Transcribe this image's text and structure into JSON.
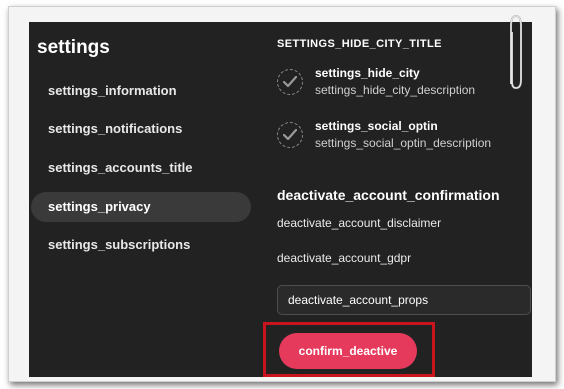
{
  "sidebar": {
    "title": "settings",
    "items": [
      {
        "label": "settings_information",
        "active": false
      },
      {
        "label": "settings_notifications",
        "active": false
      },
      {
        "label": "settings_accounts_title",
        "active": false
      },
      {
        "label": "settings_privacy",
        "active": true
      },
      {
        "label": "settings_subscriptions",
        "active": false
      }
    ]
  },
  "content": {
    "section_title": "SETTINGS_HIDE_CITY_TITLE",
    "options": [
      {
        "title": "settings_hide_city",
        "description": "settings_hide_city_description",
        "checked": true
      },
      {
        "title": "settings_social_optin",
        "description": "settings_social_optin_description",
        "checked": true
      }
    ],
    "deactivate": {
      "title": "deactivate_account_confirmation",
      "disclaimer": "deactivate_account_disclaimer",
      "gdpr": "deactivate_account_gdpr",
      "props_field": "deactivate_account_props",
      "confirm_label": "confirm_deactive"
    }
  },
  "colors": {
    "panel_bg": "#222222",
    "active_item_bg": "#3a3a3a",
    "confirm_button": "#e63a5c",
    "highlight_border": "#c8141c"
  }
}
